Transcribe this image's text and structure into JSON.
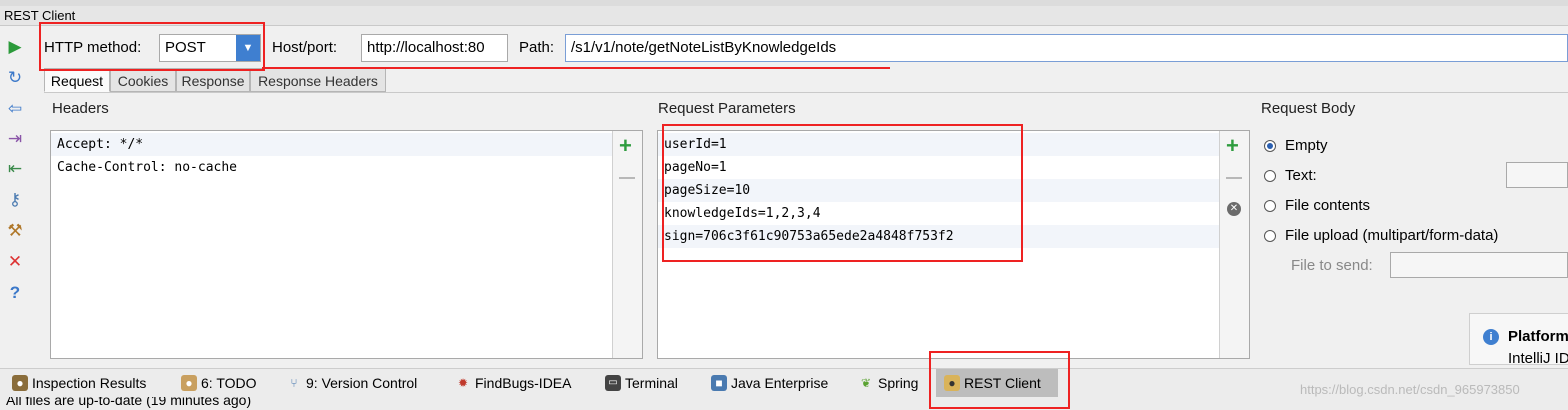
{
  "window": {
    "title": "REST Client"
  },
  "toolbar": {
    "icons": [
      "run-icon",
      "refresh-icon",
      "back-icon",
      "export-icon",
      "import-icon",
      "keys-icon",
      "settings-icon",
      "close-icon",
      "help-icon"
    ]
  },
  "request": {
    "method_label": "HTTP method:",
    "method_value": "POST",
    "host_label": "Host/port:",
    "host_value": "http://localhost:80",
    "path_label": "Path:",
    "path_value": "/s1/v1/note/getNoteListByKnowledgeIds"
  },
  "tabs": [
    {
      "label": "Request",
      "active": true
    },
    {
      "label": "Cookies",
      "active": false
    },
    {
      "label": "Response",
      "active": false
    },
    {
      "label": "Response Headers",
      "active": false
    }
  ],
  "headers": {
    "title": "Headers",
    "rows": [
      "Accept: */*",
      "Cache-Control: no-cache"
    ]
  },
  "params": {
    "title": "Request Parameters",
    "rows": [
      "userId=1",
      "pageNo=1",
      "pageSize=10",
      "knowledgeIds=1,2,3,4",
      "sign=706c3f61c90753a65ede2a4848f753f2"
    ]
  },
  "body": {
    "title": "Request Body",
    "options": [
      {
        "label": "Empty",
        "checked": true
      },
      {
        "label": "Text:",
        "checked": false
      },
      {
        "label": "File contents",
        "checked": false
      },
      {
        "label": "File upload (multipart/form-data)",
        "checked": false
      }
    ],
    "file_label": "File to send:"
  },
  "notification": {
    "title": "Platform",
    "text": "IntelliJ ID"
  },
  "bottom_tabs": [
    {
      "label": "Inspection Results",
      "icon": "inspector-icon",
      "active": false
    },
    {
      "label": "6: TODO",
      "icon": "todo-icon",
      "active": false
    },
    {
      "label": "9: Version Control",
      "icon": "version-control-icon",
      "active": false
    },
    {
      "label": "FindBugs-IDEA",
      "icon": "bug-icon",
      "active": false
    },
    {
      "label": "Terminal",
      "icon": "terminal-icon",
      "active": false
    },
    {
      "label": "Java Enterprise",
      "icon": "java-enterprise-icon",
      "active": false
    },
    {
      "label": "Spring",
      "icon": "spring-icon",
      "active": false
    },
    {
      "label": "REST Client",
      "icon": "rest-client-icon",
      "active": true
    }
  ],
  "status": "All files are up-to-date (19 minutes ago)",
  "watermark": "https://blog.csdn.net/csdn_965973850",
  "colors": {
    "accent": "#3f7fd0",
    "annotation": "#e22222",
    "add": "#2e9c3e"
  }
}
